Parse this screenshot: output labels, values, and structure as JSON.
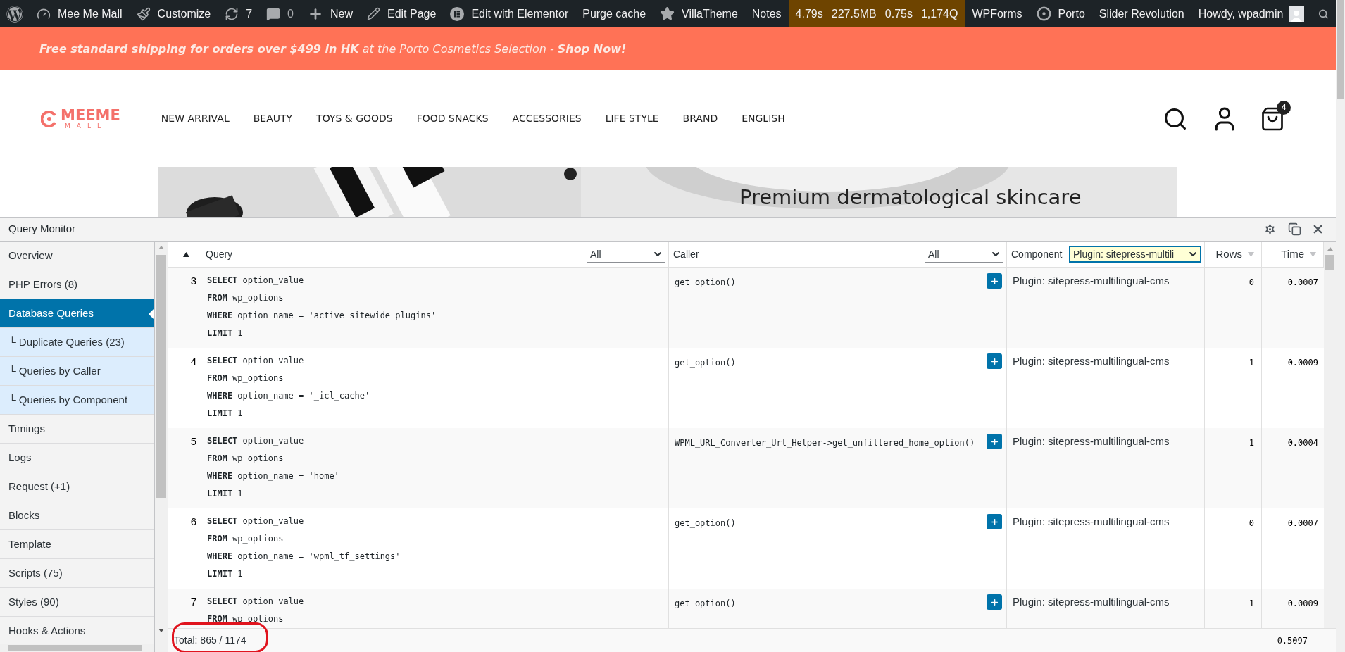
{
  "admin_bar": {
    "items": [
      {
        "kind": "logo"
      },
      {
        "kind": "link",
        "label": "Mee Me Mall"
      },
      {
        "kind": "link",
        "label": "Customize"
      },
      {
        "kind": "link",
        "label": "7"
      },
      {
        "kind": "link",
        "label": "0"
      },
      {
        "kind": "link",
        "label": "New"
      },
      {
        "kind": "link",
        "label": "Edit Page"
      },
      {
        "kind": "link",
        "label": "Edit with Elementor"
      },
      {
        "kind": "link",
        "label": "Purge cache"
      },
      {
        "kind": "link",
        "label": "VillaTheme"
      },
      {
        "kind": "link",
        "label": "Notes"
      },
      {
        "kind": "stats",
        "values": [
          "4.79s",
          "227.5MB",
          "0.75s",
          "1,174Q"
        ]
      },
      {
        "kind": "link",
        "label": "WPForms"
      },
      {
        "kind": "link",
        "label": "Porto"
      },
      {
        "kind": "link",
        "label": "Slider Revolution"
      }
    ],
    "account": "Howdy, wpadmin"
  },
  "promo": {
    "text": "**Free standard shipping for orders over $499 in HK** at the Porto Cosmetics Selection - ",
    "link": "Shop Now!"
  },
  "header": {
    "logo": {
      "top": "MEEME",
      "bottom": "MALL"
    },
    "nav": [
      "NEW ARRIVAL",
      "BEAUTY",
      "TOYS & GOODS",
      "FOOD SNACKS",
      "ACCESSORIES",
      "LIFE STYLE",
      "BRAND",
      "ENGLISH"
    ],
    "cart_count": "4"
  },
  "banner": {
    "heading": "Premium dermatological skincare"
  },
  "qm": {
    "title": "Query Monitor",
    "sidebar": [
      {
        "label": "Overview",
        "selected": false
      },
      {
        "label": "PHP Errors (8)",
        "selected": false
      },
      {
        "label": "Database Queries",
        "selected": true,
        "children": [
          {
            "label": "└ Duplicate Queries (23)",
            "selected": false
          },
          {
            "label": "└ Queries by Caller",
            "selected": false
          },
          {
            "label": "└ Queries by Component",
            "selected": false
          }
        ]
      },
      {
        "label": "Timings",
        "selected": false
      },
      {
        "label": "Logs",
        "selected": false
      },
      {
        "label": "Request (+1)",
        "selected": false
      },
      {
        "label": "Blocks",
        "selected": false
      },
      {
        "label": "Template",
        "selected": false
      },
      {
        "label": "Scripts (75)",
        "selected": false
      },
      {
        "label": "Styles (90)",
        "selected": false
      },
      {
        "label": "Hooks & Actions",
        "selected": false
      }
    ],
    "columns": [
      {
        "kind": "sort"
      },
      {
        "kind": "filter",
        "label": "Query",
        "filter": {
          "value": "All",
          "active": false
        }
      },
      {
        "kind": "filter",
        "label": "Caller",
        "filter": {
          "value": "All",
          "active": false
        }
      },
      {
        "kind": "filter",
        "label": "Component",
        "filter": {
          "value": "Plugin: sitepress-multili",
          "active": true
        }
      },
      {
        "kind": "sortable",
        "label": "Rows"
      },
      {
        "kind": "sortable",
        "label": "Time"
      }
    ],
    "rows": [
      {
        "num": "3",
        "query": [
          "**SELECT** option_value",
          "**FROM** wp_options",
          "**WHERE** option_name = 'active_sitewide_plugins'",
          "**LIMIT** 1"
        ],
        "caller": "get_option()",
        "component": "Plugin: sitepress-multilingual-cms",
        "rows": "0",
        "time": "0.0007"
      },
      {
        "num": "4",
        "query": [
          "**SELECT** option_value",
          "**FROM** wp_options",
          "**WHERE** option_name = '_icl_cache'",
          "**LIMIT** 1"
        ],
        "caller": "get_option()",
        "component": "Plugin: sitepress-multilingual-cms",
        "rows": "1",
        "time": "0.0009"
      },
      {
        "num": "5",
        "query": [
          "**SELECT** option_value",
          "**FROM** wp_options",
          "**WHERE** option_name = 'home'",
          "**LIMIT** 1"
        ],
        "caller": "WPML_URL_Converter_Url_Helper->get_unfiltered_home_option()",
        "component": "Plugin: sitepress-multilingual-cms",
        "rows": "1",
        "time": "0.0004"
      },
      {
        "num": "6",
        "query": [
          "**SELECT** option_value",
          "**FROM** wp_options",
          "**WHERE** option_name = 'wpml_tf_settings'",
          "**LIMIT** 1"
        ],
        "caller": "get_option()",
        "component": "Plugin: sitepress-multilingual-cms",
        "rows": "0",
        "time": "0.0007"
      },
      {
        "num": "7",
        "query": [
          "**SELECT** option_value",
          "**FROM** wp_options"
        ],
        "caller": "get_option()",
        "component": "Plugin: sitepress-multilingual-cms",
        "rows": "1",
        "time": "0.0009"
      }
    ],
    "footer": {
      "total": "Total: 865 / 1174",
      "time": "0.5097"
    }
  }
}
